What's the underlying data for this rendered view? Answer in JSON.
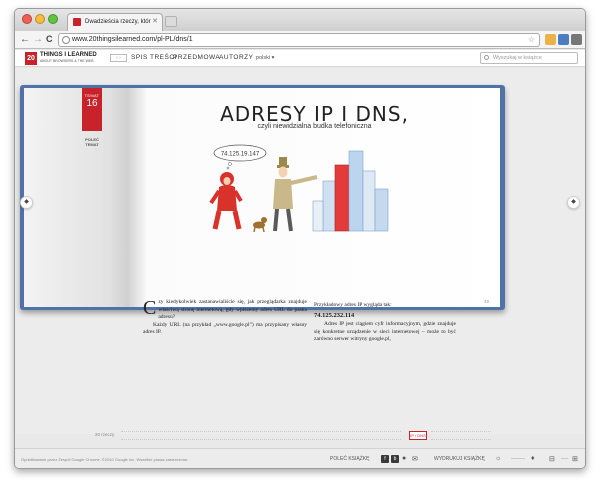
{
  "browser": {
    "tab_title": "Dwadzieścia rzeczy, któr",
    "tab_close": "✕",
    "url": "www.20thingsilearned.com/pl-PL/dns/1",
    "back": "←",
    "forward": "→",
    "reload": "C",
    "star": "☆"
  },
  "site": {
    "logo_number": "20",
    "logo_title": "THINGS I LEARNED",
    "logo_subtitle": "ABOUT BROWSERS & THE WEB",
    "arrows": "‹ ›",
    "nav": {
      "contents": "SPIS TREŚCI",
      "foreword": "PRZEDMOWA",
      "authors": "AUTORZY"
    },
    "language": "polski ▾",
    "search_placeholder": "Wyszukaj w książce"
  },
  "page": {
    "ribbon_label": "TEMAT",
    "ribbon_number": "16",
    "recommend_line1": "POLEĆ",
    "recommend_line2": "TEMAT",
    "title": "ADRESY IP I DNS,",
    "subtitle": "czyli niewidzialna budka telefoniczna",
    "bubble_ip": "74.125.19.147",
    "col1_dropcap": "C",
    "col1_p1": "zy kiedykolwiek zastanawialiście się, jak przeglądarka znajduje właściwą stronę internetową, gdy wpiszemy adres URL do paska adresu?",
    "col1_p2": "Każdy URL (na przykład „www.google.pl”) ma przypisany własny adres IP.",
    "col2_p1": "Przykładowy adres IP wygląda tak:",
    "col2_ip": "74.125.232.114",
    "col2_p2": "Adres IP jest ciągiem cyfr informacyjnym, gdzie znajduje się konkretne urządzenie w sieci internetowej – może to być zarówno serwer witryny google.pl,",
    "page_number": "49",
    "prev_arrow": "◆",
    "next_arrow": "◆"
  },
  "thumbnails": {
    "label": "20 rzeczy",
    "active_label": "IP / DNS"
  },
  "footer": {
    "copyright": "Opublikowane przez Zespół Google Chrome. ©2010 Google Inc. Wszelkie prawa zastrzeżone.",
    "share": "POLEĆ KSIĄŻKĘ",
    "print": "WYDRUKUJ KSIĄŻKĘ",
    "facebook": "f",
    "buzz": "b"
  },
  "colors": {
    "brand_red": "#c8232b",
    "book_cover": "#4f72a8"
  }
}
